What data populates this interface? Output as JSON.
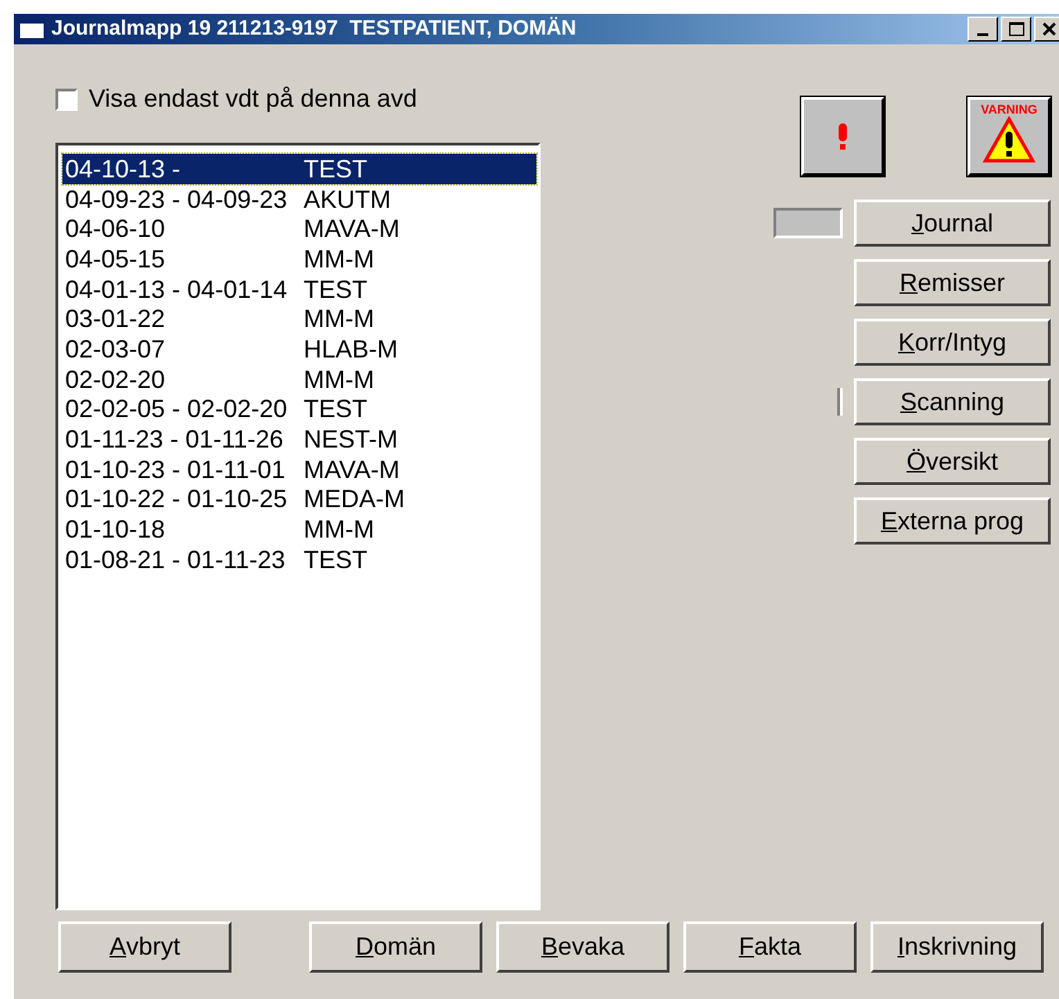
{
  "window": {
    "title": "Journalmapp 19 211213-9197  TESTPATIENT, DOMÄN"
  },
  "filter_checkbox": {
    "label": "Visa endast vdt på denna avd",
    "checked": false
  },
  "visits": [
    {
      "dates": "04-10-13 -",
      "unit": "TEST",
      "selected": true
    },
    {
      "dates": "04-09-23 - 04-09-23",
      "unit": "AKUTM",
      "selected": false
    },
    {
      "dates": "04-06-10",
      "unit": "MAVA-M",
      "selected": false
    },
    {
      "dates": "04-05-15",
      "unit": "MM-M",
      "selected": false
    },
    {
      "dates": "04-01-13 - 04-01-14",
      "unit": "TEST",
      "selected": false
    },
    {
      "dates": "03-01-22",
      "unit": "MM-M",
      "selected": false
    },
    {
      "dates": "02-03-07",
      "unit": "HLAB-M",
      "selected": false
    },
    {
      "dates": "02-02-20",
      "unit": "MM-M",
      "selected": false
    },
    {
      "dates": "02-02-05 - 02-02-20",
      "unit": "TEST",
      "selected": false
    },
    {
      "dates": "01-11-23 - 01-11-26",
      "unit": "NEST-M",
      "selected": false
    },
    {
      "dates": "01-10-23 - 01-11-01",
      "unit": "MAVA-M",
      "selected": false
    },
    {
      "dates": "01-10-22 - 01-10-25",
      "unit": "MEDA-M",
      "selected": false
    },
    {
      "dates": "01-10-18",
      "unit": "MM-M",
      "selected": false
    },
    {
      "dates": "01-08-21 - 01-11-23",
      "unit": "TEST",
      "selected": false
    }
  ],
  "warning_button": {
    "label": "VARNING"
  },
  "side_buttons": [
    {
      "accel": "J",
      "rest": "ournal",
      "kind": "boxed"
    },
    {
      "accel": "R",
      "rest": "emisser",
      "kind": "plain"
    },
    {
      "accel": "K",
      "rest": "orr/Intyg",
      "kind": "plain"
    },
    {
      "accel": "S",
      "rest": "canning",
      "kind": "barred"
    },
    {
      "accel": "Ö",
      "rest": "versikt",
      "kind": "plain"
    },
    {
      "accel": "E",
      "rest": "xterna prog",
      "kind": "plain"
    }
  ],
  "bottom_buttons": [
    {
      "accel": "A",
      "rest": "vbryt"
    },
    {
      "accel": "D",
      "rest": "omän"
    },
    {
      "accel": "B",
      "rest": "evaka"
    },
    {
      "accel": "F",
      "rest": "akta"
    },
    {
      "accel": "I",
      "rest": "nskrivning"
    }
  ]
}
